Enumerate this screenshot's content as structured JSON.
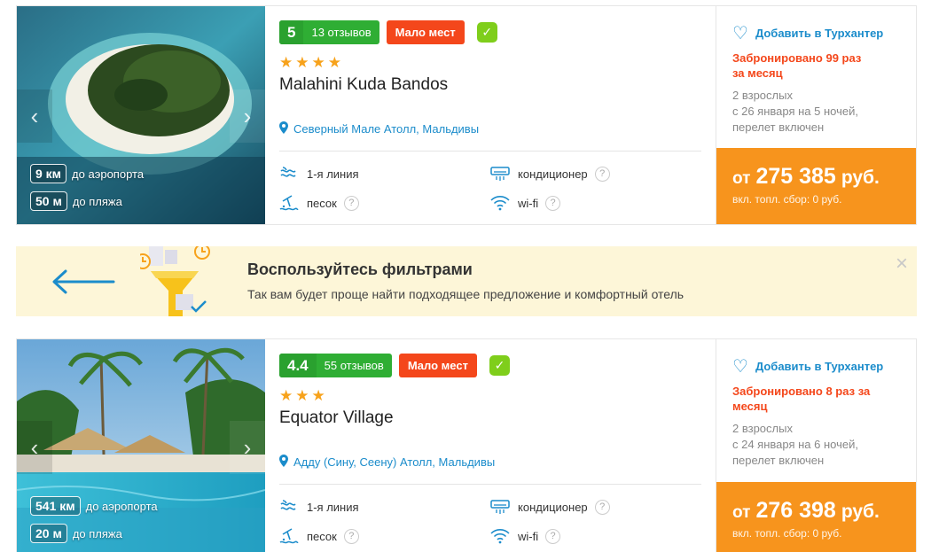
{
  "hotels": [
    {
      "score": "5",
      "reviews": "13 отзывов",
      "few_seats": "Мало мест",
      "stars": "★★★★",
      "name": "Malahini Kuda Bandos",
      "location": "Северный Мале Атолл, Мальдивы",
      "airport_dist": "9 км",
      "airport_label": "до аэропорта",
      "beach_dist": "50 м",
      "beach_label": "до пляжа",
      "features": {
        "line": "1-я линия",
        "sand": "песок",
        "ac": "кондиционер",
        "wifi": "wi-fi"
      },
      "favorite": "Добавить в Турхантер",
      "booked": "Забронировано 99 раз за месяц",
      "guests": "2 взрослых",
      "dates": "с 26 января на 5 ночей,",
      "flight": "перелет включен",
      "price_prefix": "от",
      "price": "275 385",
      "currency": "руб.",
      "fee": "вкл. топл. сбор: 0 руб."
    },
    {
      "score": "4.4",
      "reviews": "55 отзывов",
      "few_seats": "Мало мест",
      "stars": "★★★",
      "name": "Equator Village",
      "location": "Адду (Сину, Сеену) Атолл, Мальдивы",
      "airport_dist": "541 км",
      "airport_label": "до аэропорта",
      "beach_dist": "20 м",
      "beach_label": "до пляжа",
      "features": {
        "line": "1-я линия",
        "sand": "песок",
        "ac": "кондиционер",
        "wifi": "wi-fi"
      },
      "favorite": "Добавить в Турхантер",
      "booked": "Забронировано 8 раз за месяц",
      "guests": "2 взрослых",
      "dates": "с 24 января на 6 ночей,",
      "flight": "перелет включен",
      "price_prefix": "от",
      "price": "276 398",
      "currency": "руб.",
      "fee": "вкл. топл. сбор: 0 руб."
    }
  ],
  "banner": {
    "title": "Воспользуйтесь фильтрами",
    "text": "Так вам будет проще найти подходящее предложение и комфортный отель",
    "close": "×"
  },
  "help_mark": "?",
  "colors": {
    "accent_blue": "#1b8ccb",
    "rating_green": "#2fae34",
    "alert_red": "#f4471b",
    "price_orange": "#f7941d",
    "banner_bg": "#fdf6d8"
  }
}
